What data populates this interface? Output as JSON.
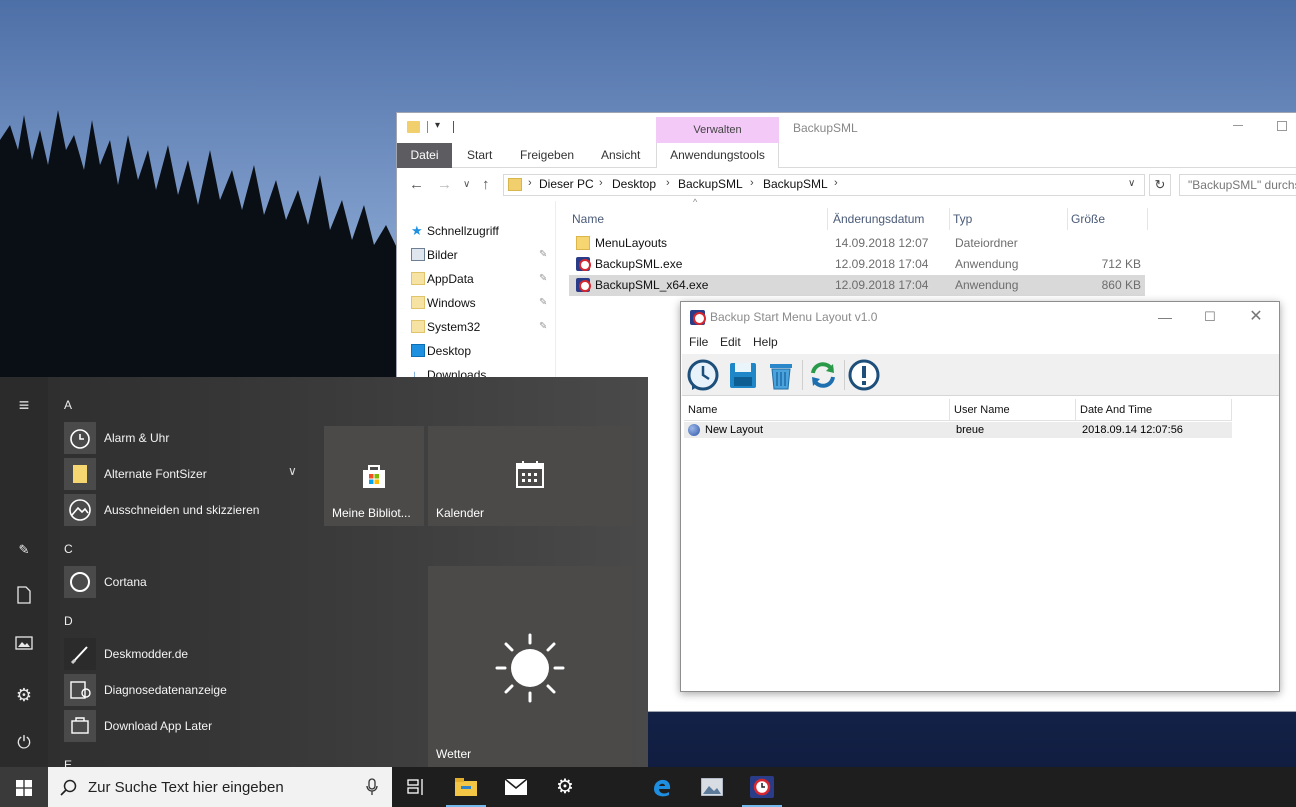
{
  "explorer": {
    "window_title": "BackupSML",
    "context_tab_group": "Verwalten",
    "ribbon_tabs": [
      "Datei",
      "Start",
      "Freigeben",
      "Ansicht",
      "Anwendungstools"
    ],
    "breadcrumb": [
      "Dieser PC",
      "Desktop",
      "BackupSML",
      "BackupSML"
    ],
    "search_placeholder": "\"BackupSML\" durchs",
    "nav": [
      {
        "label": "Schnellzugriff",
        "icon": "star-icon"
      },
      {
        "label": "Bilder",
        "icon": "pictures-icon"
      },
      {
        "label": "AppData",
        "icon": "folder-icon"
      },
      {
        "label": "Windows",
        "icon": "folder-icon"
      },
      {
        "label": "System32",
        "icon": "folder-icon"
      },
      {
        "label": "Desktop",
        "icon": "desktop-icon"
      },
      {
        "label": "Downloads",
        "icon": "download-icon"
      }
    ],
    "columns": [
      "Name",
      "Änderungsdatum",
      "Typ",
      "Größe"
    ],
    "files": [
      {
        "name": "MenuLayouts",
        "date": "14.09.2018 12:07",
        "type": "Dateiordner",
        "size": ""
      },
      {
        "name": "BackupSML.exe",
        "date": "12.09.2018 17:04",
        "type": "Anwendung",
        "size": "712 KB"
      },
      {
        "name": "BackupSML_x64.exe",
        "date": "12.09.2018 17:04",
        "type": "Anwendung",
        "size": "860 KB"
      }
    ]
  },
  "backup_dialog": {
    "title": "Backup Start Menu Layout v1.0",
    "menu": [
      "File",
      "Edit",
      "Help"
    ],
    "toolbar_icons": [
      "backup-clock-icon",
      "save-icon",
      "recycle-bin-icon",
      "refresh-icon",
      "info-icon"
    ],
    "columns": [
      "Name",
      "User Name",
      "Date And Time"
    ],
    "rows": [
      {
        "name": "New Layout",
        "user": "breue",
        "datetime": "2018.09.14 12:07:56"
      }
    ]
  },
  "start_menu": {
    "groups": [
      {
        "letter": "A",
        "apps": [
          "Alarm & Uhr",
          "Alternate FontSizer",
          "Ausschneiden und skizzieren"
        ]
      },
      {
        "letter": "C",
        "apps": [
          "Cortana"
        ]
      },
      {
        "letter": "D",
        "apps": [
          "Deskmodder.de",
          "Diagnosedatenanzeige",
          "Download App Later"
        ]
      },
      {
        "letter": "E",
        "apps": []
      }
    ],
    "tiles": [
      "Meine Bibliot...",
      "Kalender",
      "Wetter"
    ]
  },
  "taskbar": {
    "search_placeholder": "Zur Suche Text hier eingeben"
  },
  "colors": {
    "explorer_datei_tab": "#5d5c60",
    "verwalten_bg": "#f2c9f7",
    "start_bg": "#3a3a3a",
    "taskbar_bg": "#1e1e1e"
  }
}
